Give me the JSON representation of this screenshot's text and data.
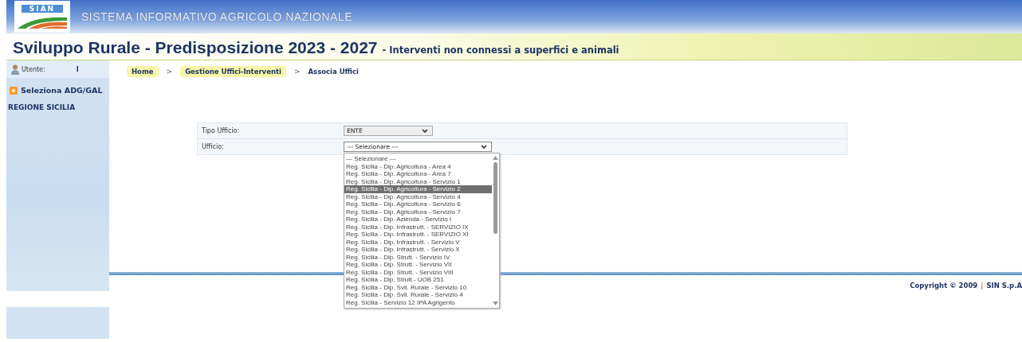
{
  "header": {
    "logo_text": "SIAN",
    "system_name": "SISTEMA INFORMATIVO AGRICOLO NAZIONALE"
  },
  "title_bar": {
    "title": "Sviluppo Rurale - Predisposizione 2023 - 2027",
    "subtitle": "- Interventi non connessi a superfici e animali"
  },
  "sidebar": {
    "user_label": "Utente:",
    "user_value": "I",
    "menu_item": "Seleziona ADG/GAL",
    "region": "REGIONE SICILIA"
  },
  "breadcrumb": [
    {
      "label": "Home",
      "kind": "link"
    },
    {
      "label": ">",
      "kind": "separator"
    },
    {
      "label": "Gestione Uffici-Interventi",
      "kind": "link"
    },
    {
      "label": ">",
      "kind": "separator"
    },
    {
      "label": "Associa Uffici",
      "kind": "current"
    }
  ],
  "form": {
    "rows": [
      {
        "label": "Tipo Ufficio:",
        "value": "ENTE",
        "kind": "short"
      },
      {
        "label": "Ufficio:",
        "value": "--- Selezionare ---",
        "kind": "long"
      }
    ]
  },
  "dropdown_options": [
    {
      "label": "--- Selezionare ---",
      "selected": false
    },
    {
      "label": "Reg. Sicilia - Dip. Agricoltura - Area 4",
      "selected": false
    },
    {
      "label": "Reg. Sicilia - Dip. Agricoltura - Area 7",
      "selected": false
    },
    {
      "label": "Reg. Sicilia - Dip. Agricoltura - Servizio 1",
      "selected": false
    },
    {
      "label": "Reg. Sicilia - Dip. Agricoltura - Servizio 2",
      "selected": true
    },
    {
      "label": "Reg. Sicilia - Dip. Agricoltura - Servizio 4",
      "selected": false
    },
    {
      "label": "Reg. Sicilia - Dip. Agricoltura - Servizio 6",
      "selected": false
    },
    {
      "label": "Reg. Sicilia - Dip. Agricoltura - Servizio 7",
      "selected": false
    },
    {
      "label": "Reg. Sicilia - Dip. Azienda - Servizio I",
      "selected": false
    },
    {
      "label": "Reg. Sicilia - Dip. Infrastrutt. - SERVIZIO IX",
      "selected": false
    },
    {
      "label": "Reg. Sicilia - Dip. Infrastrutt. - SERVIZIO XI",
      "selected": false
    },
    {
      "label": "Reg. Sicilia - Dip. Infrastrutt. - Servizio V",
      "selected": false
    },
    {
      "label": "Reg. Sicilia - Dip. Infrastrutt. - Servizio X",
      "selected": false
    },
    {
      "label": "Reg. Sicilia - Dip. Strutt. - Servizio IV",
      "selected": false
    },
    {
      "label": "Reg. Sicilia - Dip. Strutt. - Servizio VII",
      "selected": false
    },
    {
      "label": "Reg. Sicilia - Dip. Strutt. - Servizio VIII",
      "selected": false
    },
    {
      "label": "Reg. Sicilia - Dip. Strutt.- UOB 251",
      "selected": false
    },
    {
      "label": "Reg. Sicilia - Dip. Svil. Rurale - Servizio 10",
      "selected": false
    },
    {
      "label": "Reg. Sicilia - Dip. Svil. Rurale - Servizio 4",
      "selected": false
    },
    {
      "label": "Reg. Sicilia - Servizio 12 IPA Agrigento",
      "selected": false
    }
  ],
  "footer": {
    "copyright": "Copyright © 2009",
    "separator": "|",
    "company": "SIN S.p.A"
  }
}
